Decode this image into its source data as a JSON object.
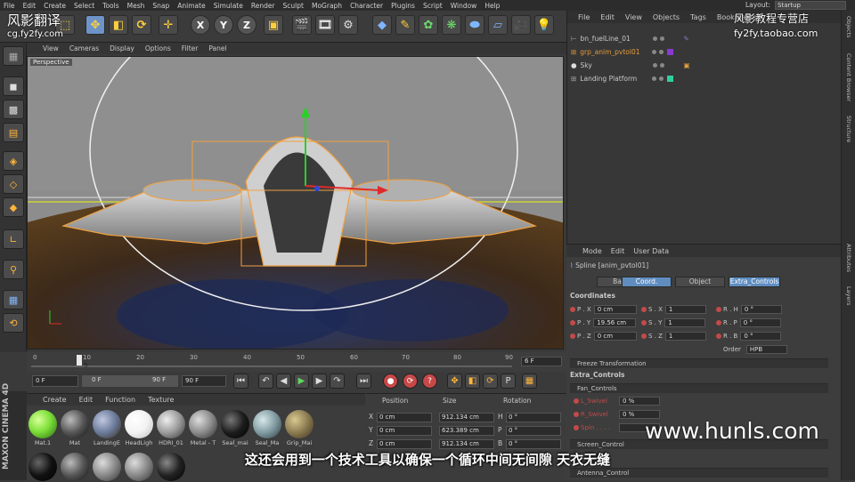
{
  "menubar": {
    "items": [
      "File",
      "Edit",
      "Create",
      "Select",
      "Tools",
      "Mesh",
      "Snap",
      "Animate",
      "Simulate",
      "Render",
      "Sculpt",
      "MoGraph",
      "Character",
      "Plugins",
      "Script",
      "Window",
      "Help"
    ],
    "layout_label": "Layout:",
    "layout_value": "Startup"
  },
  "toolbar": {
    "axis_x": "X",
    "axis_y": "Y",
    "axis_z": "Z"
  },
  "viewport": {
    "menu": [
      "View",
      "Cameras",
      "Display",
      "Options",
      "Filter",
      "Panel"
    ],
    "label": "Perspective"
  },
  "timeline": {
    "ticks": [
      "0",
      "10",
      "20",
      "30",
      "40",
      "50",
      "60",
      "70",
      "80",
      "90"
    ],
    "current_frame_marker": "5",
    "fps_field": "6 F"
  },
  "playback": {
    "start_field": "0 F",
    "range_start": "0 F",
    "range_end": "90 F",
    "end_field": "90 F"
  },
  "materials": {
    "menu": [
      "Create",
      "Edit",
      "Function",
      "Texture"
    ],
    "items": [
      {
        "name": "Mat.1",
        "color": "#7fe03a"
      },
      {
        "name": "Mat",
        "color": "#555555"
      },
      {
        "name": "LandingE",
        "color": "#6a7a9a"
      },
      {
        "name": "HeadLigh",
        "color": "#f2f2f2"
      },
      {
        "name": "HDRI_01",
        "color": "#9a9a9a"
      },
      {
        "name": "Metal - T",
        "color": "#8a8a8a"
      },
      {
        "name": "Seal_mai",
        "color": "#1c1c1c"
      },
      {
        "name": "Seal_Ma",
        "color": "#7f9aa0"
      },
      {
        "name": "Grip_Mai",
        "color": "#8a7a50"
      }
    ],
    "brand": "MAXON CINEMA 4D"
  },
  "coords": {
    "headers": [
      "Position",
      "Size",
      "Rotation"
    ],
    "rows": [
      {
        "axis": "X",
        "pos": "0 cm",
        "size": "912.134 cm",
        "rot_label": "H",
        "rot": "0 °"
      },
      {
        "axis": "Y",
        "pos": "0 cm",
        "size": "623.389 cm",
        "rot_label": "P",
        "rot": "0 °"
      },
      {
        "axis": "Z",
        "pos": "0 cm",
        "size": "912.134 cm",
        "rot_label": "B",
        "rot": "0 °"
      }
    ]
  },
  "objects": {
    "menu": [
      "File",
      "Edit",
      "View",
      "Objects",
      "Tags",
      "Bookmarks"
    ],
    "rows": [
      {
        "name": "bn_fuelLine_01",
        "color": "#cfcfcf",
        "tag": ""
      },
      {
        "name": "grp_anim_pvtol01",
        "color": "#e49a3a",
        "tag": "#8a3ad0"
      },
      {
        "name": "Sky",
        "color": "#cfcfcf",
        "tag": ""
      },
      {
        "name": "Landing Platform",
        "color": "#cfcfcf",
        "tag": "#2fd0a0"
      }
    ]
  },
  "sidetabs": [
    "Objects",
    "Content Browser",
    "Structure",
    "Attributes",
    "Layers"
  ],
  "attributes": {
    "menu": [
      "Mode",
      "Edit",
      "User Data"
    ],
    "object_title": "Spline [anim_pvtol01]",
    "tabs": [
      "Basic",
      "Coord.",
      "Object",
      "Extra_Controls"
    ],
    "selected_tab": "Coord.",
    "section_coordinates": "Coordinates",
    "params": [
      {
        "p": "P . X",
        "pv": "0 cm",
        "s": "S . X",
        "sv": "1",
        "r": "R . H",
        "rv": "0 °"
      },
      {
        "p": "P . Y",
        "pv": "19.56 cm",
        "s": "S . Y",
        "sv": "1",
        "r": "R . P",
        "rv": "0 °"
      },
      {
        "p": "P . Z",
        "pv": "0 cm",
        "s": "S . Z",
        "sv": "1",
        "r": "R . B",
        "rv": "0 °"
      }
    ],
    "order_label": "Order",
    "order_value": "HPB",
    "freeze": "Freeze Transformation",
    "section_extra": "Extra_Controls",
    "fan_controls": "Fan_Controls",
    "fan_params": [
      {
        "label": "L_Swivel",
        "value": "0 %"
      },
      {
        "label": "R_Swivel",
        "value": "0 %"
      },
      {
        "label": "Spin . . . .",
        "value": ""
      }
    ],
    "screen_control": "Screen_Control",
    "antenna_control": "Antenna_Control"
  },
  "watermarks": {
    "top_left": "风影翻译",
    "top_left_url": "cg.fy2fy.com",
    "top_right": "风影教程专营店",
    "top_right_url": "fy2fy.taobao.com",
    "bottom_right": "www.hunls.com"
  },
  "subtitle": "这还会用到一个技术工具以确保一个循环中间无间隙 天衣无缝"
}
